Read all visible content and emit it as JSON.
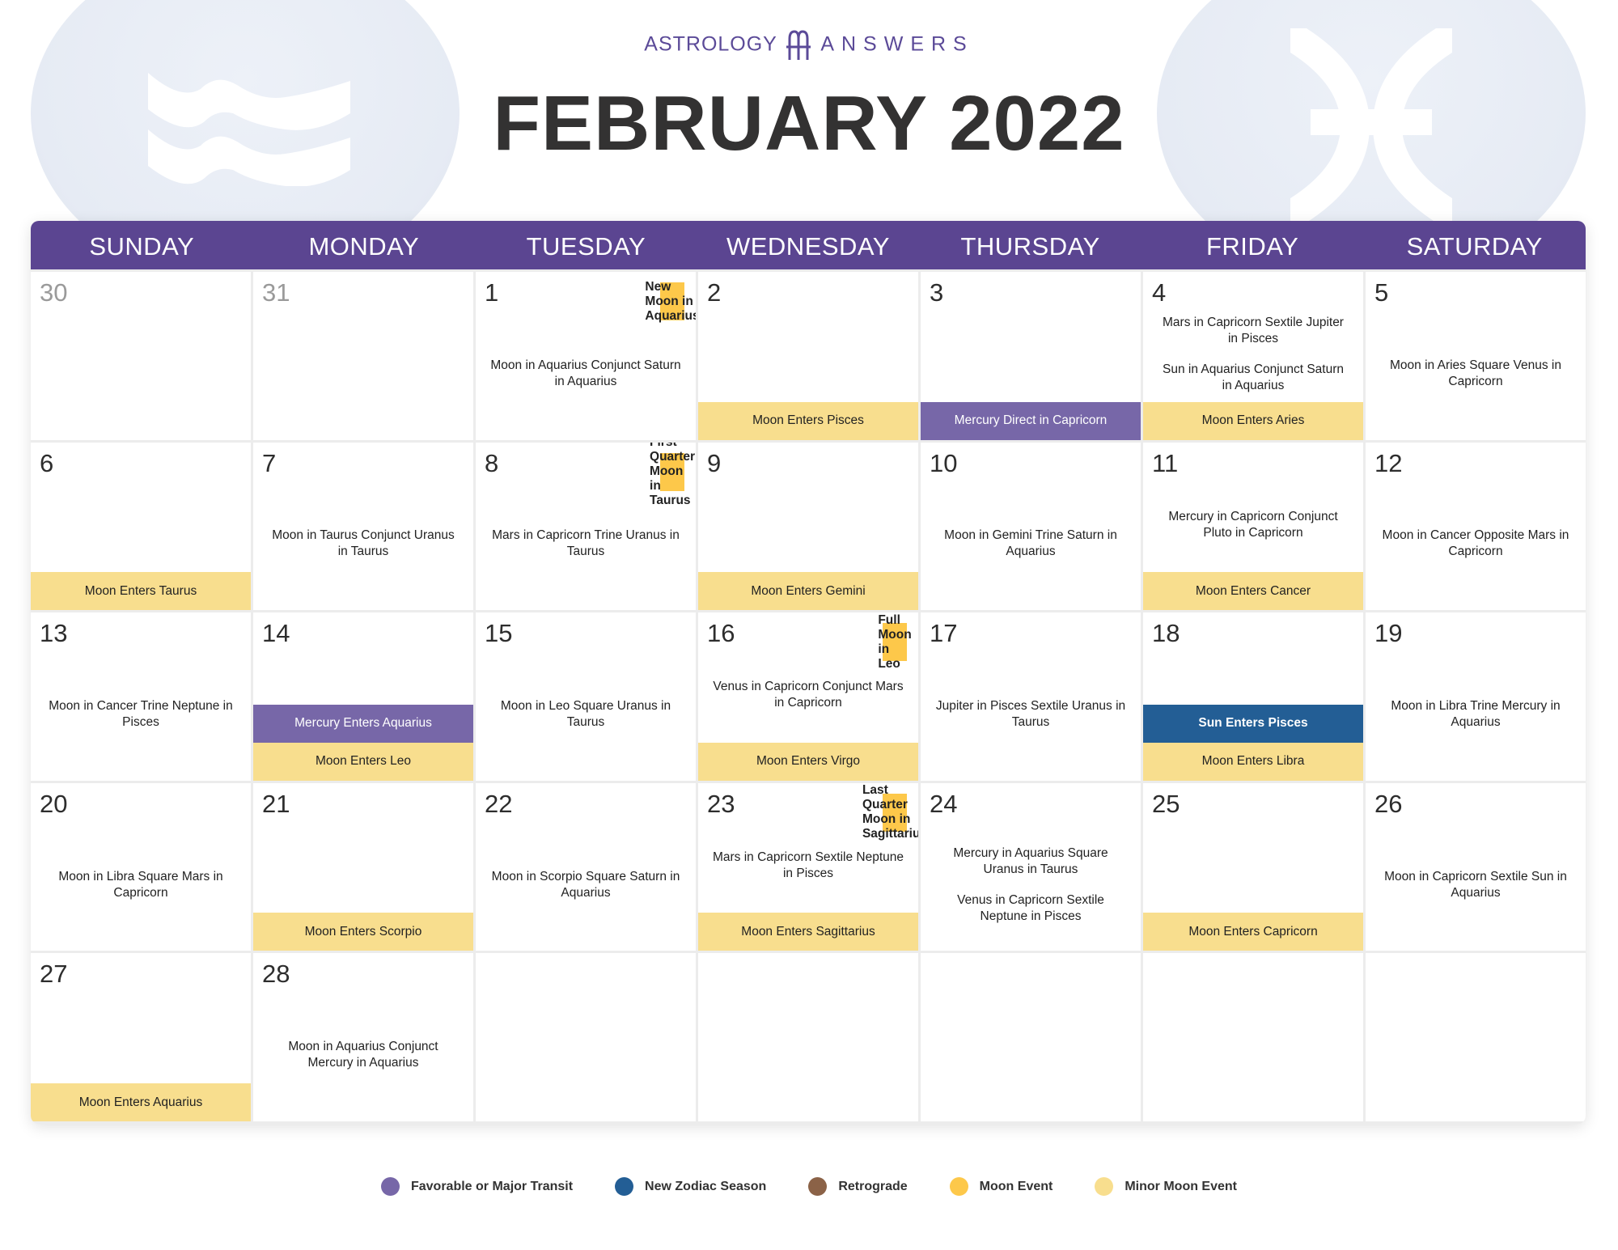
{
  "logo": {
    "left": "ASTROLOGY",
    "right": "ANSWERS",
    "color": "#5b4a98"
  },
  "title": "FEBRUARY 2022",
  "signs": {
    "left": "aquarius-icon",
    "right": "pisces-icon"
  },
  "days_of_week": [
    "SUNDAY",
    "MONDAY",
    "TUESDAY",
    "WEDNESDAY",
    "THURSDAY",
    "FRIDAY",
    "SATURDAY"
  ],
  "colors": {
    "header": "#5b4591",
    "major": "#7767a8",
    "zodiac": "#235e95",
    "retrograde": "#8b6247",
    "moon": "#fdc84a",
    "minor": "#f8de8e"
  },
  "cells": [
    {
      "day": "30",
      "other": true,
      "events": [],
      "bands": []
    },
    {
      "day": "31",
      "other": true,
      "events": [],
      "bands": []
    },
    {
      "day": "1",
      "moon": "new",
      "events": [
        "Moon in Aquarius Conjunct Saturn in Aquarius"
      ],
      "bands": [
        {
          "type": "moon",
          "label": "New Moon in Aquarius"
        }
      ]
    },
    {
      "day": "2",
      "events": [],
      "bands": [
        {
          "type": "minor",
          "label": "Moon Enters Pisces"
        }
      ]
    },
    {
      "day": "3",
      "events": [],
      "bands": [
        {
          "type": "major",
          "label": "Mercury Direct in Capricorn"
        }
      ]
    },
    {
      "day": "4",
      "events": [
        "Mars in Capricorn Sextile Jupiter in Pisces",
        "Sun in Aquarius Conjunct Saturn in Aquarius"
      ],
      "bands": [
        {
          "type": "minor",
          "label": "Moon Enters Aries"
        }
      ]
    },
    {
      "day": "5",
      "events": [
        "Moon in Aries Square Venus in Capricorn"
      ],
      "bands": []
    },
    {
      "day": "6",
      "events": [],
      "bands": [
        {
          "type": "minor",
          "label": "Moon Enters Taurus"
        }
      ]
    },
    {
      "day": "7",
      "events": [
        "Moon in Taurus Conjunct Uranus in Taurus"
      ],
      "bands": []
    },
    {
      "day": "8",
      "moon": "first",
      "events": [
        "Mars in Capricorn Trine Uranus in Taurus"
      ],
      "bands": [
        {
          "type": "moon",
          "label": "First Quarter Moon in Taurus"
        }
      ]
    },
    {
      "day": "9",
      "events": [],
      "bands": [
        {
          "type": "minor",
          "label": "Moon Enters Gemini"
        }
      ]
    },
    {
      "day": "10",
      "events": [
        "Moon in Gemini Trine Saturn in Aquarius"
      ],
      "bands": []
    },
    {
      "day": "11",
      "events": [
        "Mercury in Capricorn Conjunct Pluto in Capricorn"
      ],
      "bands": [
        {
          "type": "minor",
          "label": "Moon Enters Cancer"
        }
      ]
    },
    {
      "day": "12",
      "events": [
        "Moon in Cancer Opposite Mars in Capricorn"
      ],
      "bands": []
    },
    {
      "day": "13",
      "events": [
        "Moon in Cancer Trine Neptune in Pisces"
      ],
      "bands": []
    },
    {
      "day": "14",
      "events": [],
      "bands": [
        {
          "type": "major",
          "label": "Mercury Enters Aquarius"
        },
        {
          "type": "minor",
          "label": "Moon Enters Leo"
        }
      ]
    },
    {
      "day": "15",
      "events": [
        "Moon in Leo Square Uranus in Taurus"
      ],
      "bands": []
    },
    {
      "day": "16",
      "moon": "full",
      "events": [
        "Venus in Capricorn Conjunct Mars in Capricorn"
      ],
      "bands": [
        {
          "type": "moon",
          "label": "Full Moon in Leo"
        },
        {
          "type": "minor",
          "label": "Moon Enters Virgo"
        }
      ]
    },
    {
      "day": "17",
      "events": [
        "Jupiter in Pisces Sextile Uranus in Taurus"
      ],
      "bands": []
    },
    {
      "day": "18",
      "events": [],
      "bands": [
        {
          "type": "zodiac",
          "label": "Sun Enters Pisces"
        },
        {
          "type": "minor",
          "label": "Moon Enters Libra"
        }
      ]
    },
    {
      "day": "19",
      "events": [
        "Moon in Libra Trine Mercury in Aquarius"
      ],
      "bands": []
    },
    {
      "day": "20",
      "events": [
        "Moon in Libra Square Mars in Capricorn"
      ],
      "bands": []
    },
    {
      "day": "21",
      "events": [],
      "bands": [
        {
          "type": "minor",
          "label": "Moon Enters Scorpio"
        }
      ]
    },
    {
      "day": "22",
      "events": [
        "Moon in Scorpio Square Saturn in Aquarius"
      ],
      "bands": []
    },
    {
      "day": "23",
      "moon": "last",
      "events": [
        "Mars in Capricorn Sextile Neptune in Pisces"
      ],
      "bands": [
        {
          "type": "moon",
          "label": "Last Quarter Moon in Sagittarius"
        },
        {
          "type": "minor",
          "label": "Moon Enters Sagittarius"
        }
      ]
    },
    {
      "day": "24",
      "events": [
        "Mercury in Aquarius Square Uranus in Taurus",
        "Venus in Capricorn Sextile Neptune in Pisces"
      ],
      "bands": []
    },
    {
      "day": "25",
      "events": [],
      "bands": [
        {
          "type": "minor",
          "label": "Moon Enters Capricorn"
        }
      ]
    },
    {
      "day": "26",
      "events": [
        "Moon in Capricorn Sextile Sun in Aquarius"
      ],
      "bands": []
    },
    {
      "day": "27",
      "events": [],
      "bands": [
        {
          "type": "minor",
          "label": "Moon Enters Aquarius"
        }
      ]
    },
    {
      "day": "28",
      "events": [
        "Moon in Aquarius Conjunct Mercury in Aquarius"
      ],
      "bands": []
    },
    {
      "day": "",
      "events": [],
      "bands": []
    },
    {
      "day": "",
      "events": [],
      "bands": []
    },
    {
      "day": "",
      "events": [],
      "bands": []
    },
    {
      "day": "",
      "events": [],
      "bands": []
    },
    {
      "day": "",
      "events": [],
      "bands": []
    }
  ],
  "legend": [
    {
      "label": "Favorable or Major Transit",
      "color": "#7767a8"
    },
    {
      "label": "New Zodiac Season",
      "color": "#235e95"
    },
    {
      "label": "Retrograde",
      "color": "#8b6247"
    },
    {
      "label": "Moon Event",
      "color": "#fdc84a"
    },
    {
      "label": "Minor Moon Event",
      "color": "#f8de8e"
    }
  ]
}
